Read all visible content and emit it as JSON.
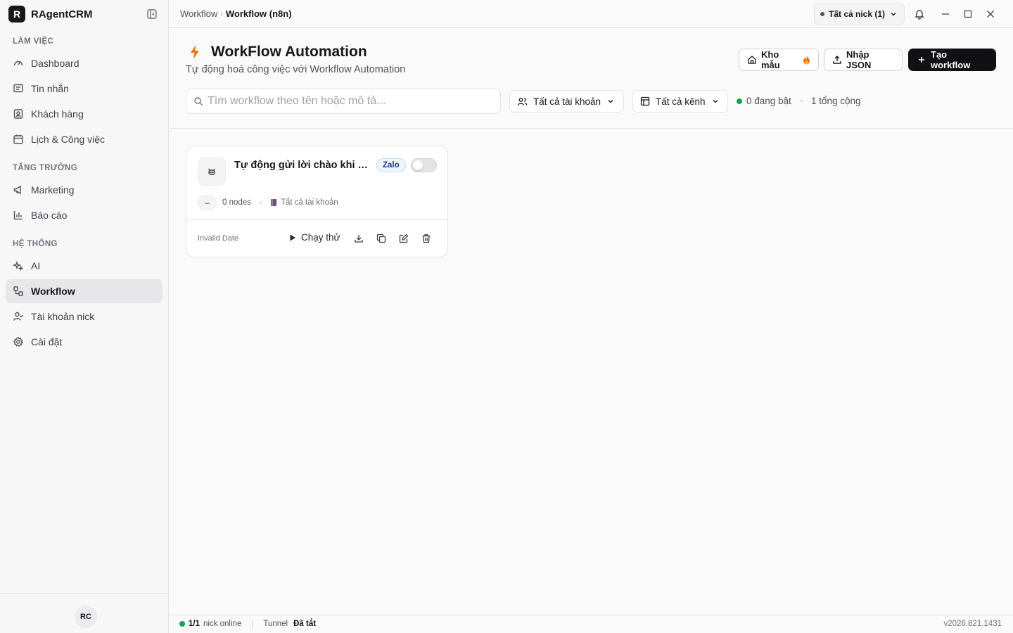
{
  "app": {
    "logo_letter": "R",
    "name": "RAgentCRM"
  },
  "sidebar": {
    "sections": [
      {
        "label": "LÀM VIỆC"
      },
      {
        "label": "TĂNG TRƯỞNG"
      },
      {
        "label": "HỆ THỐNG"
      }
    ],
    "items": [
      {
        "label": "Dashboard",
        "icon": "gauge-icon"
      },
      {
        "label": "Tin nhắn",
        "icon": "message-icon"
      },
      {
        "label": "Khách hàng",
        "icon": "contact-icon"
      },
      {
        "label": "Lịch & Công việc",
        "icon": "calendar-icon"
      },
      {
        "label": "Marketing",
        "icon": "megaphone-icon"
      },
      {
        "label": "Báo cáo",
        "icon": "bar-chart-icon"
      },
      {
        "label": "AI",
        "icon": "sparkles-icon"
      },
      {
        "label": "Workflow",
        "icon": "workflow-icon",
        "active": true
      },
      {
        "label": "Tài khoản nick",
        "icon": "user-check-icon"
      },
      {
        "label": "Cài đặt",
        "icon": "gear-icon"
      }
    ],
    "avatar_initials": "RC"
  },
  "topbar": {
    "breadcrumb": [
      "Workflow",
      "Workflow (n8n)"
    ],
    "nick_select": "Tất cả nick (1)"
  },
  "header": {
    "title": "WorkFlow Automation",
    "subtitle": "Tự động hoá công việc với Workflow Automation",
    "buttons": {
      "templates": "Kho mẫu",
      "import_json": "Nhập JSON",
      "create": "Tạo workflow"
    },
    "search": {
      "value": "",
      "placeholder": "Tìm workflow theo tên hoặc mô tả..."
    },
    "filters": {
      "accounts": "Tất cả tài khoản",
      "channels": "Tất cả kênh"
    },
    "stats": {
      "active": "0 đang bật",
      "total": "1 tổng cộng"
    }
  },
  "workflows": [
    {
      "title": "Tự động gửi lời chào khi kết bạn",
      "channel": "Zalo",
      "enabled": false,
      "nodes_chip": "–",
      "nodes": "0 nodes",
      "account": "Tất cả tài khoản",
      "date": "Invalid Date",
      "run_label": "Chạy thử"
    }
  ],
  "statusbar": {
    "online_count": "1/1",
    "online_label": "nick online",
    "tunnel_label": "Tunnel",
    "tunnel_status": "Đã tắt",
    "version": "v2026.821.1431"
  },
  "colors": {
    "accent_dark": "#111113",
    "online_green": "#16a34a",
    "bolt_orange": "#f97316",
    "zalo_blue": "#1e3a8a"
  }
}
